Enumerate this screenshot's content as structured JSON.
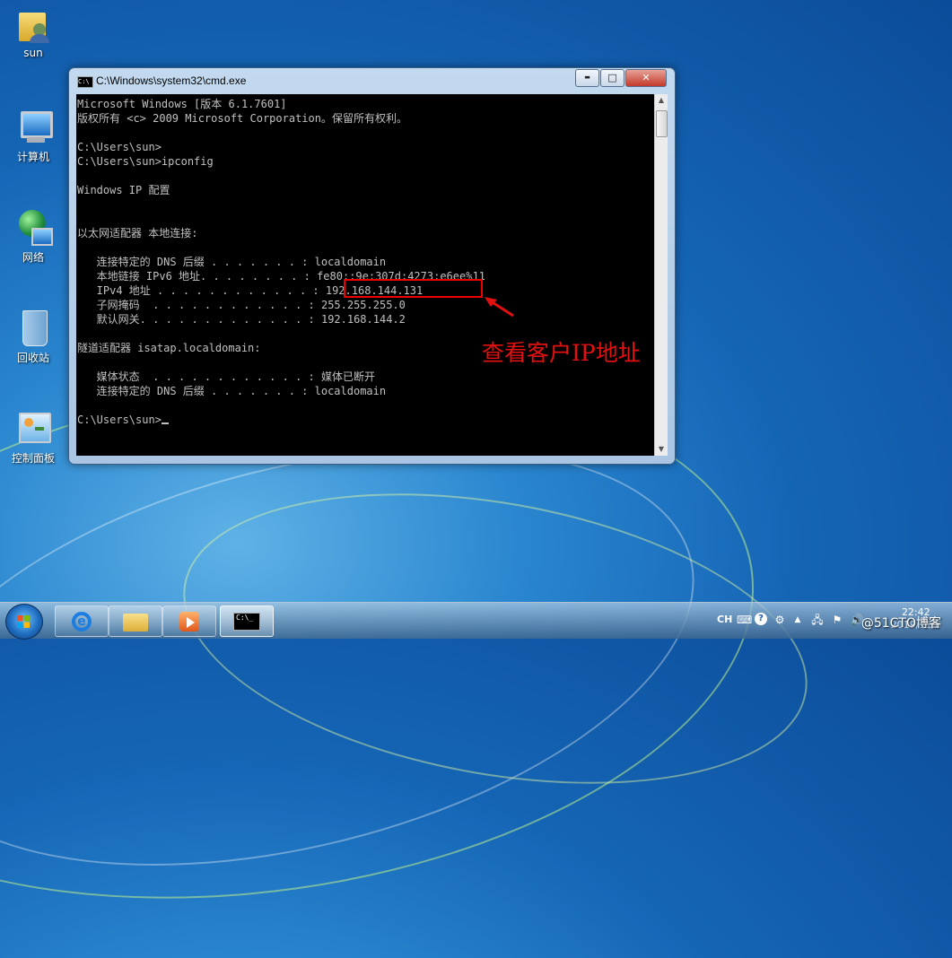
{
  "desktop": {
    "icons": [
      {
        "label": "sun"
      },
      {
        "label": "计算机"
      },
      {
        "label": "网络"
      },
      {
        "label": "回收站"
      },
      {
        "label": "控制面板"
      }
    ]
  },
  "window": {
    "title": "C:\\Windows\\system32\\cmd.exe",
    "controls": {
      "minimize": "▬",
      "maximize": "□",
      "close": "✕"
    },
    "console_lines": [
      "Microsoft Windows [版本 6.1.7601]",
      "版权所有 <c> 2009 Microsoft Corporation。保留所有权利。",
      "",
      "C:\\Users\\sun>",
      "C:\\Users\\sun>ipconfig",
      "",
      "Windows IP 配置",
      "",
      "",
      "以太网适配器 本地连接:",
      "",
      "   连接特定的 DNS 后缀 . . . . . . . : localdomain",
      "   本地链接 IPv6 地址. . . . . . . . : fe80::9e:307d:4273:e6ee%11",
      "   IPv4 地址 . . . . . . . . . . . . : 192.168.144.131",
      "   子网掩码  . . . . . . . . . . . . : 255.255.255.0",
      "   默认网关. . . . . . . . . . . . . : 192.168.144.2",
      "",
      "隧道适配器 isatap.localdomain:",
      "",
      "   媒体状态  . . . . . . . . . . . . : 媒体已断开",
      "   连接特定的 DNS 后缀 . . . . . . . : localdomain",
      "",
      "C:\\Users\\sun>"
    ]
  },
  "annotation": {
    "text": "查看客户IP地址",
    "color": "#e41010"
  },
  "taskbar": {
    "apps": [
      {
        "name": "internet-explorer"
      },
      {
        "name": "file-explorer"
      },
      {
        "name": "media-player"
      },
      {
        "name": "cmd",
        "active": true
      }
    ],
    "tray": {
      "language": "CH",
      "time": "22:42",
      "date": "2019/11/6"
    },
    "watermark": "@51CTO博客"
  }
}
